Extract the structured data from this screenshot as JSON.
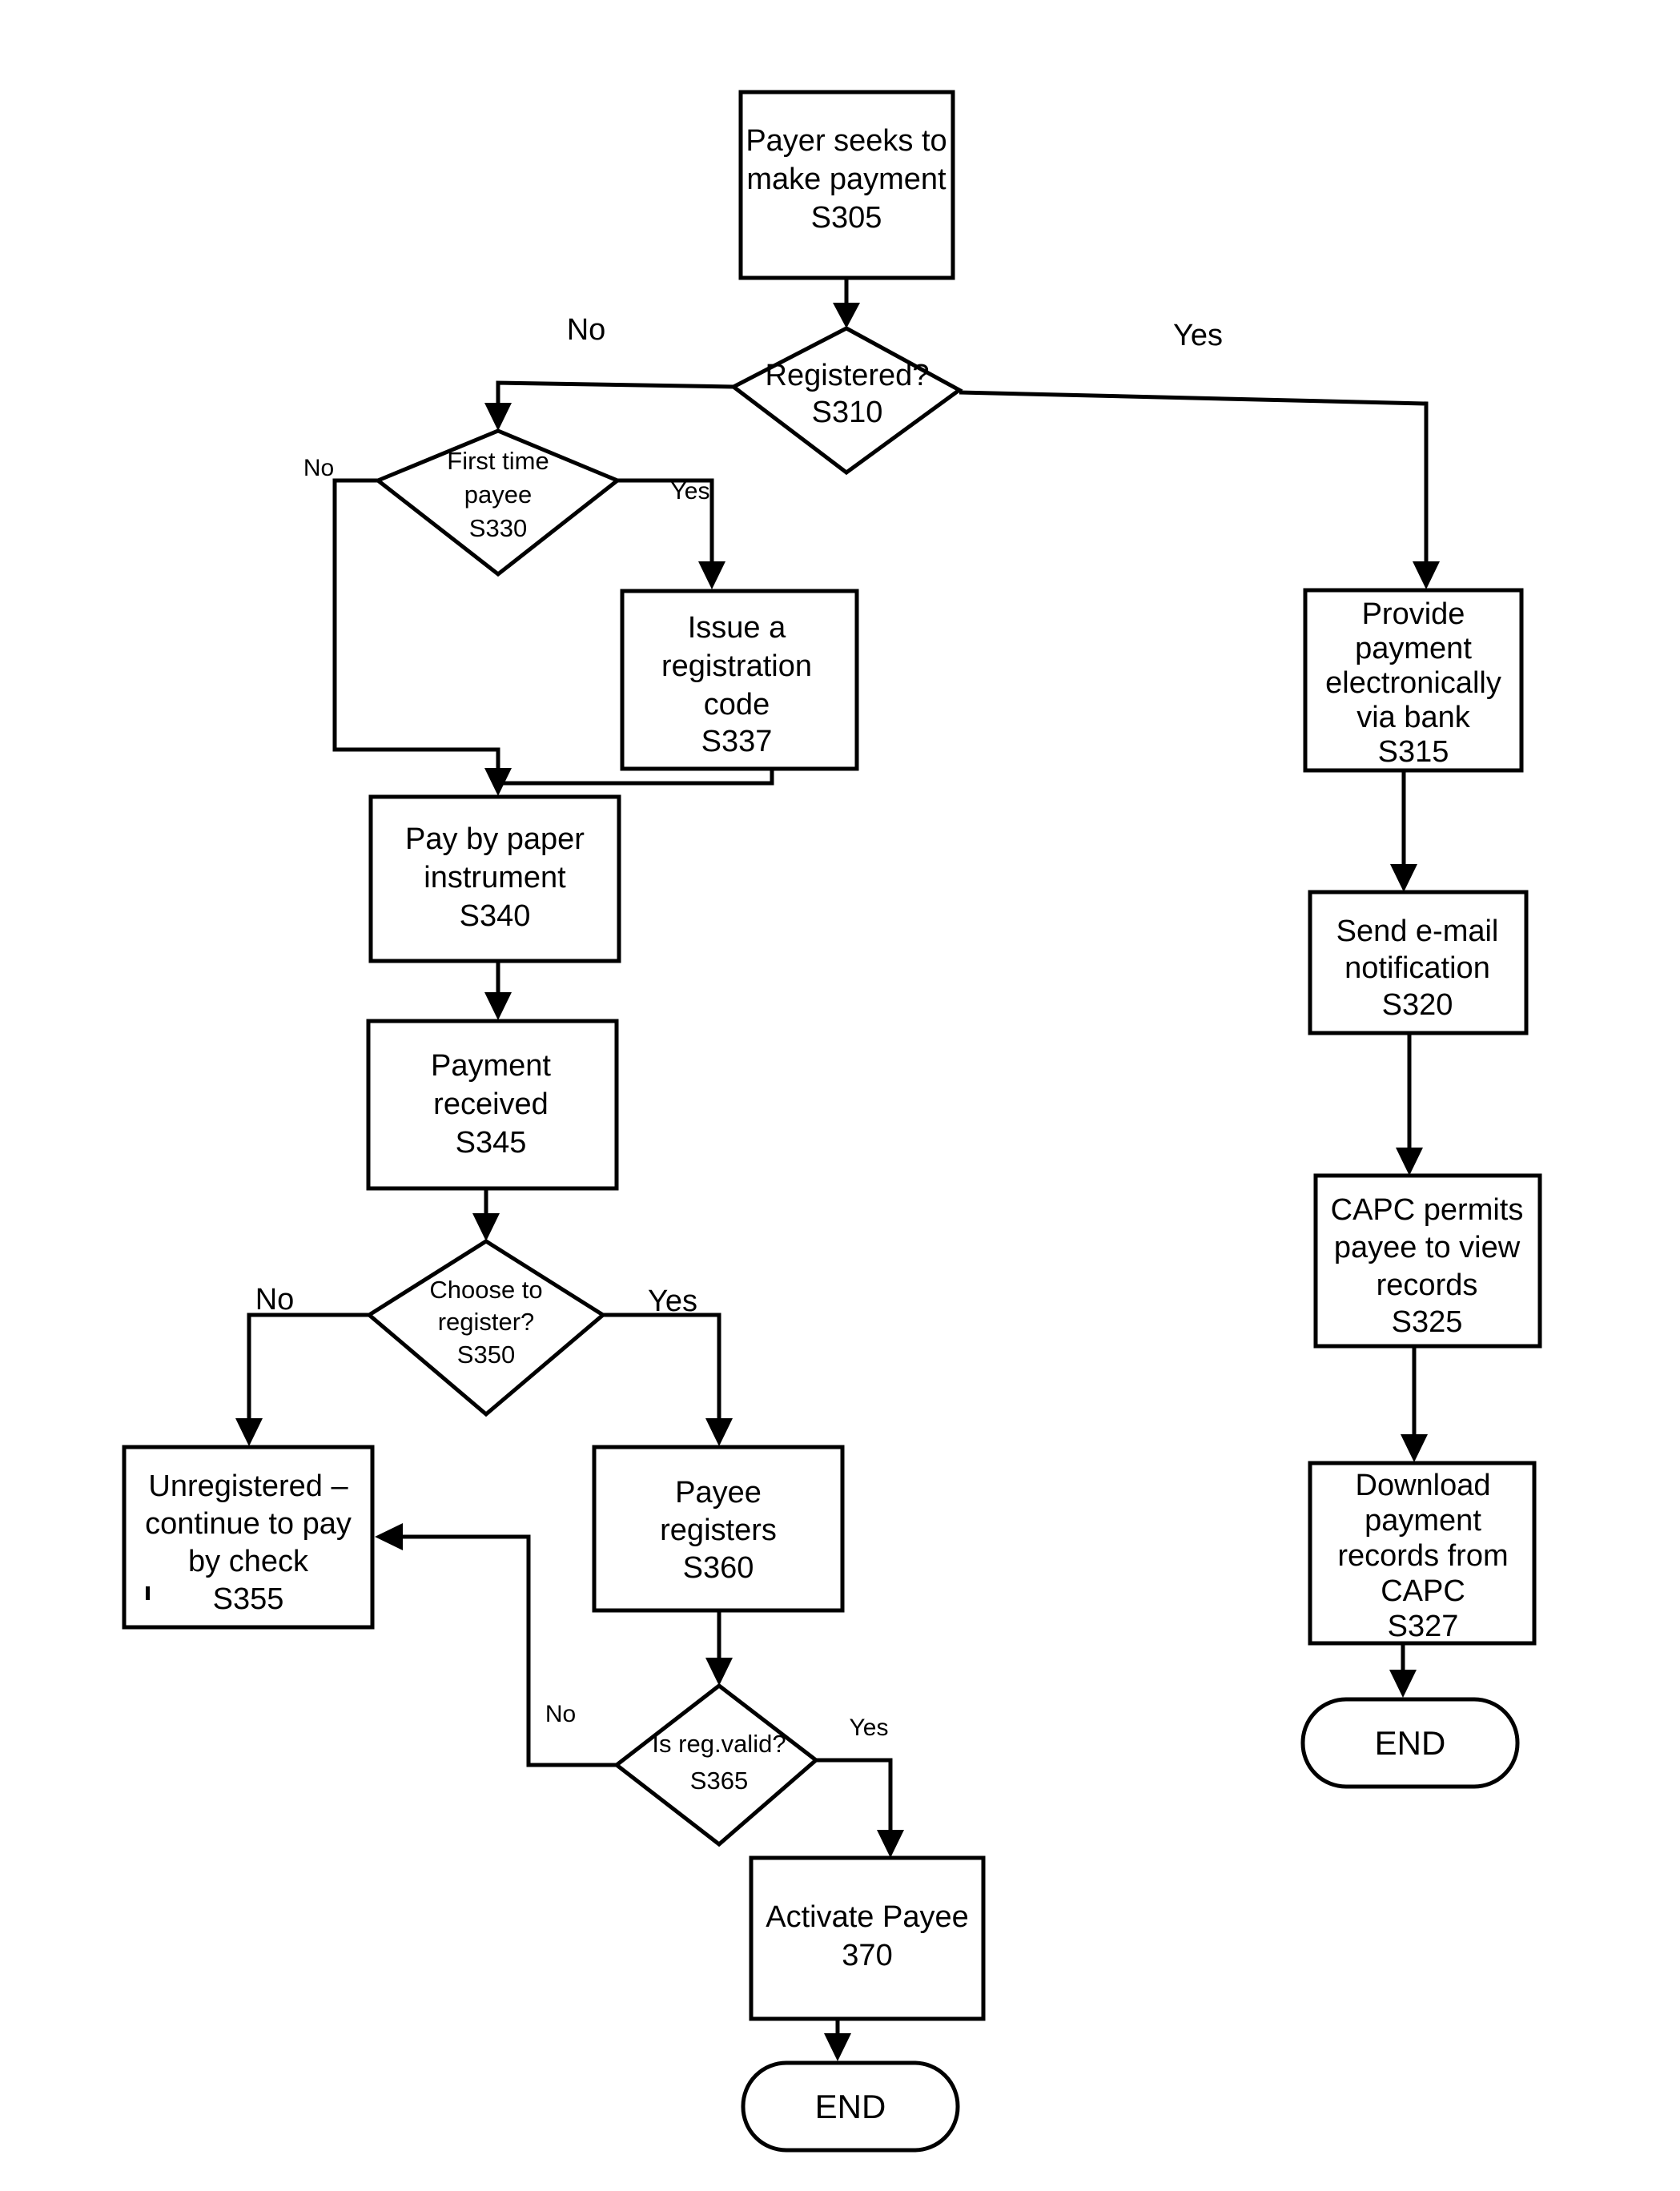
{
  "diagram": {
    "type": "flowchart",
    "title": "Payment and payee registration process flow",
    "nodes": [
      {
        "id": "S305",
        "shape": "process",
        "lines": [
          "Payer seeks to",
          "make payment",
          "S305"
        ]
      },
      {
        "id": "S310",
        "shape": "decision",
        "lines": [
          "Registered?",
          "S310"
        ]
      },
      {
        "id": "S330",
        "shape": "decision",
        "lines": [
          "First time",
          "payee",
          "S330"
        ]
      },
      {
        "id": "S337",
        "shape": "process",
        "lines": [
          "Issue a",
          "registration",
          "code",
          "S337"
        ]
      },
      {
        "id": "S315",
        "shape": "process",
        "lines": [
          "Provide",
          "payment",
          "electronically",
          "via bank",
          "S315"
        ]
      },
      {
        "id": "S320",
        "shape": "process",
        "lines": [
          "Send e-mail",
          "notification",
          "S320"
        ]
      },
      {
        "id": "S325",
        "shape": "process",
        "lines": [
          "CAPC permits",
          "payee to view",
          "records",
          "S325"
        ]
      },
      {
        "id": "S327",
        "shape": "process",
        "lines": [
          "Download",
          "payment",
          "records from",
          "CAPC",
          "S327"
        ]
      },
      {
        "id": "END_RIGHT",
        "shape": "terminal",
        "lines": [
          "END"
        ]
      },
      {
        "id": "S340",
        "shape": "process",
        "lines": [
          "Pay by paper",
          "instrument",
          "S340"
        ]
      },
      {
        "id": "S345",
        "shape": "process",
        "lines": [
          "Payment",
          "received",
          "S345"
        ]
      },
      {
        "id": "S350",
        "shape": "decision",
        "lines": [
          "Choose to",
          "register?",
          "S350"
        ]
      },
      {
        "id": "S355",
        "shape": "process",
        "lines": [
          "Unregistered –",
          "continue to pay",
          "by check",
          "S355"
        ]
      },
      {
        "id": "S360",
        "shape": "process",
        "lines": [
          "Payee",
          "registers",
          "S360"
        ]
      },
      {
        "id": "S365",
        "shape": "decision",
        "lines": [
          "Is reg.valid?",
          "S365"
        ]
      },
      {
        "id": "370",
        "shape": "process",
        "lines": [
          "Activate Payee",
          "370"
        ]
      },
      {
        "id": "END_BOTTOM",
        "shape": "terminal",
        "lines": [
          "END"
        ]
      }
    ],
    "edge_labels": {
      "s310_no": "No",
      "s310_yes": "Yes",
      "s330_no": "No",
      "s330_yes": "Yes",
      "s350_no": "No",
      "s350_yes": "Yes",
      "s365_no": "No",
      "s365_yes": "Yes"
    },
    "colors": {
      "stroke": "#000000",
      "fill": "#ffffff",
      "text": "#000000"
    }
  }
}
